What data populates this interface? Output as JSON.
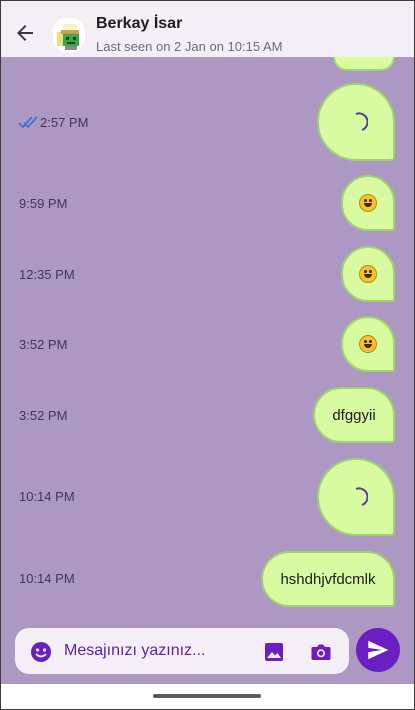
{
  "header": {
    "contact_name": "Berkay İsar",
    "last_seen": "Last seen on 2 Jan on 10:15 AM",
    "back_icon": "arrow-left-icon"
  },
  "messages": [
    {
      "time": "",
      "content_type": "loading",
      "text": ""
    },
    {
      "time": "2:57 PM",
      "content_type": "loading",
      "read_receipt": "double-check-icon",
      "text": ""
    },
    {
      "time": "9:59 PM",
      "content_type": "emoji",
      "emoji": "grinning-face-icon",
      "text": ""
    },
    {
      "time": "12:35 PM",
      "content_type": "emoji",
      "emoji": "grinning-face-icon",
      "text": ""
    },
    {
      "time": "3:52 PM",
      "content_type": "emoji",
      "emoji": "grinning-face-icon",
      "text": ""
    },
    {
      "time": "3:52 PM",
      "content_type": "text",
      "text": "dfggyii"
    },
    {
      "time": "10:14 PM",
      "content_type": "loading",
      "text": ""
    },
    {
      "time": "10:14 PM",
      "content_type": "text",
      "text": "hshdhjvfdcmlk"
    }
  ],
  "composer": {
    "placeholder": "Mesajınızı yazınız...",
    "emoji_icon": "smiley-icon",
    "gallery_icon": "image-icon",
    "camera_icon": "camera-icon",
    "send_icon": "send-icon"
  },
  "colors": {
    "chat_background": "#ad97c3",
    "bubble": "#d8fba1",
    "bubble_border": "#9fd36c",
    "accent": "#6a1fc0",
    "read_receipt": "#3b6cd6"
  }
}
